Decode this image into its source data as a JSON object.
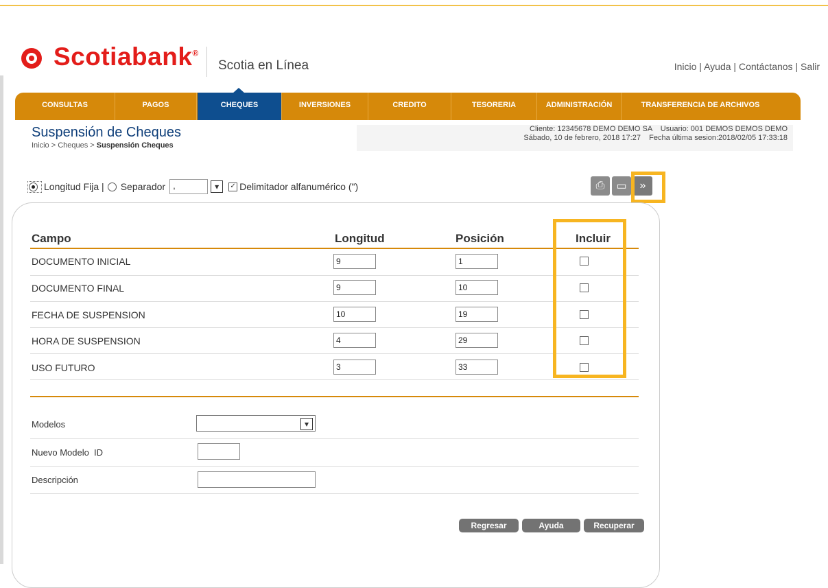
{
  "header": {
    "brand": "Scotiabank",
    "brand_reg": "®",
    "product": "Scotia en Línea",
    "links": [
      "Inicio",
      "Ayuda",
      "Contáctanos",
      "Salir"
    ],
    "link_separator": " | "
  },
  "nav": {
    "items": [
      {
        "label": "CONSULTAS"
      },
      {
        "label": "PAGOS"
      },
      {
        "label": "CHEQUES",
        "active": true
      },
      {
        "label": "INVERSIONES"
      },
      {
        "label": "CREDITO"
      },
      {
        "label": "TESORERIA"
      },
      {
        "label": "ADMINISTRACIÓN"
      },
      {
        "label": "TRANSFERENCIA DE ARCHIVOS"
      }
    ]
  },
  "page": {
    "title": "Suspensión de Cheques",
    "breadcrumb_prefix": "Inicio > Cheques > ",
    "breadcrumb_current": "Suspensión Cheques"
  },
  "info": {
    "line1": "Cliente: 12345678 DEMO DEMO SA    Usuario: 001 DEMOS DEMOS DEMO",
    "line2": "Sábado, 10 de febrero, 2018 17:27    Fecha última sesion:2018/02/05 17:33:18"
  },
  "options": {
    "fixed_label": "Longitud Fija |",
    "separator_label": "Separador",
    "separator_value": ",",
    "delimiter_label": "Delimitador alfanumérico (\")",
    "fixed_selected": true,
    "delimiter_checked": true
  },
  "table": {
    "headers": {
      "campo": "Campo",
      "longitud": "Longitud",
      "posicion": "Posición",
      "incluir": "Incluir"
    },
    "rows": [
      {
        "campo": "DOCUMENTO INICIAL",
        "longitud": "9",
        "posicion": "1"
      },
      {
        "campo": "DOCUMENTO FINAL",
        "longitud": "9",
        "posicion": "10"
      },
      {
        "campo": "FECHA DE SUSPENSION",
        "longitud": "10",
        "posicion": "19"
      },
      {
        "campo": "HORA DE SUSPENSION",
        "longitud": "4",
        "posicion": "29"
      },
      {
        "campo": "USO FUTURO",
        "longitud": "3",
        "posicion": "33"
      }
    ]
  },
  "form": {
    "modelos_label": "Modelos",
    "nuevo_label": "Nuevo Modelo  ID",
    "descripcion_label": "Descripción"
  },
  "buttons": {
    "regresar": "Regresar",
    "ayuda": "Ayuda",
    "recuperar": "Recuperar"
  },
  "colors": {
    "brand_red": "#e31d1a",
    "nav_orange": "#d6890a",
    "nav_active": "#0e4e8f",
    "highlight": "#f7b521"
  },
  "icons": [
    "print-icon",
    "save-icon",
    "double-chevron-right-icon"
  ]
}
